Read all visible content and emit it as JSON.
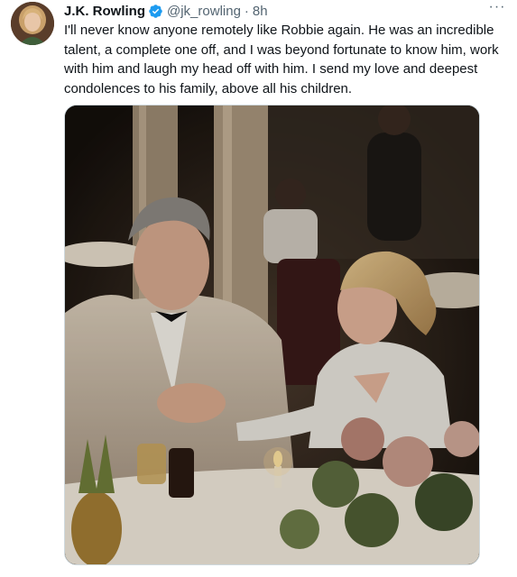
{
  "tweet": {
    "author_name": "J.K. Rowling",
    "handle": "@jk_rowling",
    "separator": "·",
    "time": "8h",
    "more_label": "···",
    "text": "I'll never know anyone remotely like Robbie again. He was an incredible talent, a complete one off, and I was beyond fortunate to know him, work with him and laugh my head off with him. I send my love and deepest condolences to his family, above all his children.",
    "avatar_icon": "profile-avatar",
    "verified_icon": "verified-badge-icon",
    "photo_description_icon": "tweet-photo"
  },
  "colors": {
    "text": "#0f1419",
    "secondary": "#536471",
    "verified": "#1d9bf0",
    "border": "#cfd9de"
  }
}
